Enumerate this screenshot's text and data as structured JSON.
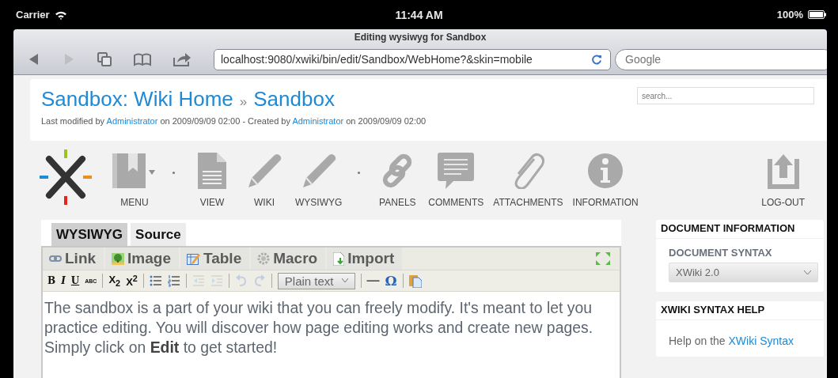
{
  "status_bar": {
    "carrier": "Carrier",
    "time": "11:44 AM",
    "battery": "100%"
  },
  "browser": {
    "title": "Editing wysiwyg for Sandbox",
    "url": "localhost:9080/xwiki/bin/edit/Sandbox/WebHome?&skin=mobile",
    "search": {
      "placeholder": "Google"
    }
  },
  "header": {
    "breadcrumb": [
      {
        "kind": "link",
        "text": "Sandbox: Wiki Home"
      },
      {
        "kind": "separator",
        "text": "»"
      },
      {
        "kind": "link",
        "text": "Sandbox"
      }
    ],
    "meta": [
      {
        "kind": "text",
        "text": "Last modified by "
      },
      {
        "kind": "link",
        "text": "Administrator"
      },
      {
        "kind": "text",
        "text": " on 2009/09/09 02:00 - Created by "
      },
      {
        "kind": "link",
        "text": "Administrator"
      },
      {
        "kind": "text",
        "text": " on 2009/09/09 02:00"
      }
    ],
    "search": {
      "placeholder": "search..."
    }
  },
  "actions": [
    {
      "kind": "menu",
      "label": "MENU"
    },
    {
      "kind": "separator"
    },
    {
      "kind": "view",
      "label": "VIEW"
    },
    {
      "kind": "edit",
      "label": "WIKI"
    },
    {
      "kind": "edit",
      "label": "WYSIWYG"
    },
    {
      "kind": "separator"
    },
    {
      "kind": "panels",
      "label": "PANELS"
    },
    {
      "kind": "comments",
      "label": "COMMENTS"
    },
    {
      "kind": "attachments",
      "label": "ATTACHMENTS"
    },
    {
      "kind": "information",
      "label": "INFORMATION"
    },
    {
      "kind": "logout",
      "label": "LOG-OUT"
    }
  ],
  "editor": {
    "tabs": [
      {
        "label": "WYSIWYG",
        "selected": true
      },
      {
        "label": "Source",
        "selected": false
      }
    ],
    "insert_menu": [
      {
        "kind": "link",
        "label": "Link"
      },
      {
        "kind": "image",
        "label": "Image"
      },
      {
        "kind": "table",
        "label": "Table"
      },
      {
        "kind": "macro",
        "label": "Macro"
      },
      {
        "kind": "import",
        "label": "Import"
      }
    ],
    "format_toolbar": [
      {
        "kind": "bold",
        "label": "B",
        "disabled": false
      },
      {
        "kind": "italic",
        "label": "I",
        "disabled": false
      },
      {
        "kind": "underline",
        "label": "U",
        "disabled": false
      },
      {
        "kind": "strike",
        "label": "ABC",
        "disabled": false
      },
      {
        "kind": "sep"
      },
      {
        "kind": "script",
        "label": "X$_{2}$",
        "disabled": false
      },
      {
        "kind": "script",
        "label": "X$^{2}$",
        "disabled": false
      },
      {
        "kind": "sep"
      },
      {
        "kind": "bullets",
        "disabled": false
      },
      {
        "kind": "numbers",
        "disabled": false
      },
      {
        "kind": "sep"
      },
      {
        "kind": "outdent",
        "disabled": true
      },
      {
        "kind": "indent",
        "disabled": true
      },
      {
        "kind": "sep"
      },
      {
        "kind": "undo",
        "disabled": true
      },
      {
        "kind": "redo",
        "disabled": true
      },
      {
        "kind": "sep"
      },
      {
        "kind": "select",
        "value": "Plain text",
        "disabled": false
      },
      {
        "kind": "sep"
      },
      {
        "kind": "rule",
        "label": "—",
        "disabled": false
      },
      {
        "kind": "symbol",
        "label": "Ω",
        "disabled": false
      },
      {
        "kind": "sep"
      },
      {
        "kind": "paste",
        "disabled": false
      }
    ],
    "content": "The sandbox is a part of your wiki that you can freely modify. It's meant to let you practice editing. You will discover how page editing works and create new pages. Simply click on **Edit** to get started!"
  },
  "sidebar": [
    {
      "kind": "info",
      "title": "DOCUMENT INFORMATION",
      "field_label": "DOCUMENT SYNTAX",
      "value": "XWiki 2.0"
    },
    {
      "kind": "help",
      "title": "XWIKI SYNTAX HELP",
      "text": "Help on the ",
      "link": "XWiki Syntax"
    }
  ]
}
